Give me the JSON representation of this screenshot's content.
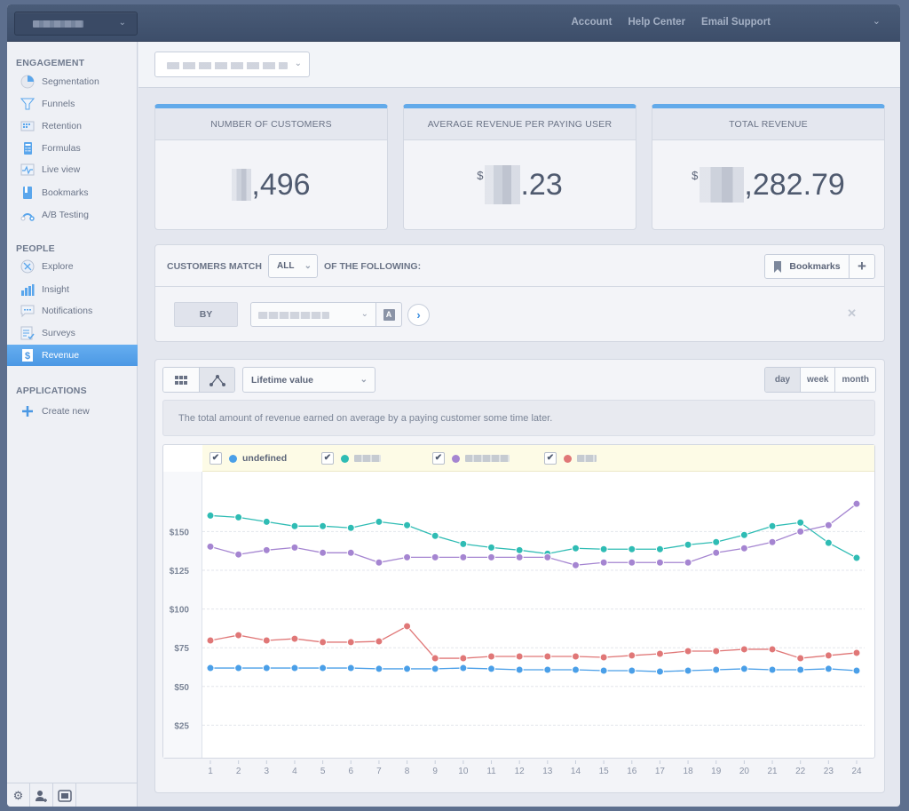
{
  "topbar": {
    "app_selector": {
      "value_redacted": true
    },
    "links": [
      "Account",
      "Help Center",
      "Email Support"
    ]
  },
  "sidebar": {
    "sections": [
      {
        "title": "ENGAGEMENT",
        "items": [
          {
            "label": "Segmentation",
            "icon": "pie-chart-icon"
          },
          {
            "label": "Funnels",
            "icon": "funnel-icon"
          },
          {
            "label": "Retention",
            "icon": "retention-grid-icon"
          },
          {
            "label": "Formulas",
            "icon": "calculator-icon"
          },
          {
            "label": "Live view",
            "icon": "live-pulse-icon"
          },
          {
            "label": "Bookmarks",
            "icon": "bookmark-icon"
          },
          {
            "label": "A/B Testing",
            "icon": "ab-test-icon"
          }
        ]
      },
      {
        "title": "PEOPLE",
        "items": [
          {
            "label": "Explore",
            "icon": "compass-icon"
          },
          {
            "label": "Insight",
            "icon": "bar-chart-icon"
          },
          {
            "label": "Notifications",
            "icon": "chat-bubble-icon"
          },
          {
            "label": "Surveys",
            "icon": "survey-checklist-icon"
          },
          {
            "label": "Revenue",
            "icon": "dollar-receipt-icon",
            "active": true
          }
        ]
      },
      {
        "title": "APPLICATIONS",
        "items": [
          {
            "label": "Create new",
            "icon": "plus-icon"
          }
        ]
      }
    ],
    "footer_icons": [
      "gear-icon",
      "add-user-icon",
      "inbox-icon"
    ]
  },
  "header": {
    "report_selector": {
      "value_redacted": true
    }
  },
  "cards": [
    {
      "title": "NUMBER OF CUSTOMERS",
      "prefix": "",
      "value_visible": ",496"
    },
    {
      "title": "AVERAGE REVENUE PER PAYING USER",
      "prefix": "$",
      "value_visible": ".23"
    },
    {
      "title": "TOTAL REVENUE",
      "prefix": "$",
      "value_visible": ",282.79"
    }
  ],
  "filter": {
    "label_before": "CUSTOMERS MATCH",
    "match_mode": "ALL",
    "label_after": "OF THE FOLLOWING:",
    "bookmarks_label": "Bookmarks",
    "by_label": "BY",
    "type_badge": "A"
  },
  "chart_panel": {
    "metric": "Lifetime value",
    "periods": [
      "day",
      "week",
      "month"
    ],
    "selected_period": "day",
    "description": "The total amount of revenue earned on average by a paying customer some time later."
  },
  "chart_data": {
    "type": "line",
    "title": "",
    "xlabel": "",
    "ylabel": "",
    "x": [
      1,
      2,
      3,
      4,
      5,
      6,
      7,
      8,
      9,
      10,
      11,
      12,
      13,
      14,
      15,
      16,
      17,
      18,
      19,
      20,
      21,
      22,
      23,
      24
    ],
    "yticks": [
      "$25",
      "$50",
      "$75",
      "$100",
      "$125",
      "$150"
    ],
    "ytick_values": [
      25,
      50,
      75,
      100,
      125,
      150
    ],
    "ylim": [
      0,
      175
    ],
    "grid": true,
    "legend_position": "top",
    "series": [
      {
        "name": "undefined",
        "color": "#4a9fe8",
        "checked": true,
        "values": [
          61.9,
          61.9,
          61.9,
          61.9,
          61.9,
          61.9,
          61.4,
          61.4,
          61.4,
          61.9,
          61.4,
          60.8,
          60.8,
          60.8,
          60.2,
          60.2,
          59.6,
          60.2,
          60.8,
          61.4,
          60.8,
          60.8,
          61.4,
          60.2
        ]
      },
      {
        "name": "Gmail",
        "color": "#2fbcb4",
        "checked": true,
        "values": [
          160.3,
          159.2,
          156.3,
          153.5,
          153.5,
          152.4,
          156.3,
          154.1,
          147.2,
          142.0,
          139.7,
          138.0,
          135.7,
          139.2,
          138.6,
          138.6,
          138.6,
          141.5,
          143.2,
          147.8,
          153.5,
          155.8,
          142.7,
          133.0
        ]
      },
      {
        "name": "[redacted]",
        "color": "#a585d1",
        "checked": true,
        "values": [
          140.3,
          135.2,
          138.0,
          139.7,
          136.3,
          136.3,
          130.0,
          133.4,
          133.4,
          133.4,
          133.4,
          133.4,
          133.4,
          128.3,
          130.0,
          130.0,
          130.0,
          130.0,
          136.3,
          139.2,
          143.2,
          150.0,
          154.1,
          167.9
        ]
      },
      {
        "name": "[redacted]",
        "color": "#e07777",
        "checked": true,
        "values": [
          79.7,
          83.1,
          79.7,
          80.8,
          78.6,
          78.6,
          79.1,
          88.9,
          68.2,
          68.2,
          69.4,
          69.4,
          69.4,
          69.4,
          68.8,
          70.0,
          71.1,
          72.8,
          72.8,
          74.0,
          74.0,
          68.2,
          70.0,
          71.7
        ]
      }
    ]
  }
}
